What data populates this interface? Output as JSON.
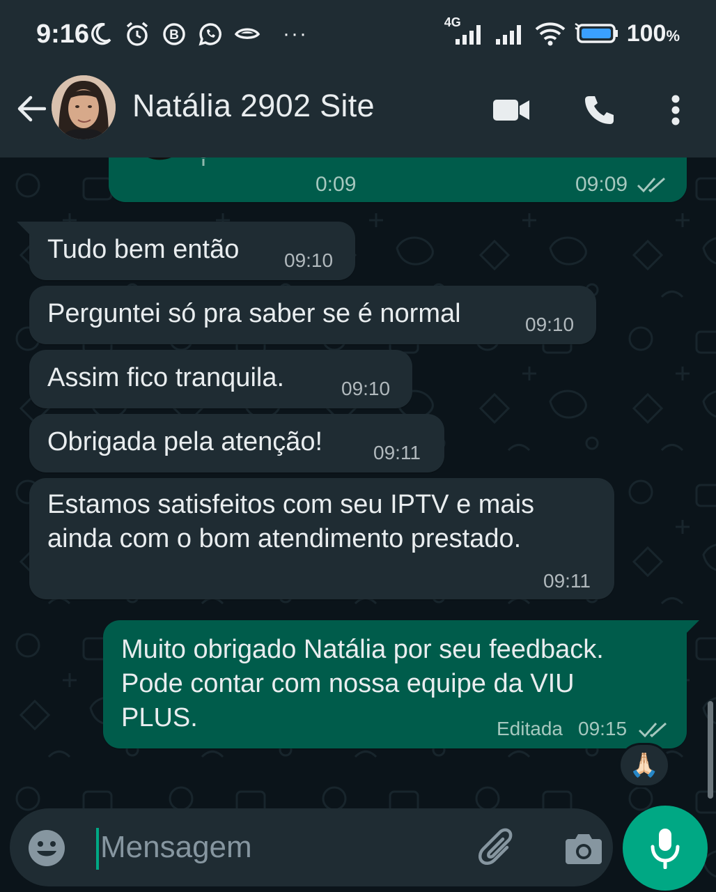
{
  "status_bar": {
    "time": "9:16",
    "network_label": "4G",
    "battery_percent": "100",
    "battery_unit": "%",
    "notification_icons": [
      "moon-icon",
      "alarm-icon",
      "b-badge-icon",
      "whatsapp-icon",
      "eye-icon",
      "more-dots-icon"
    ],
    "more_label": "···"
  },
  "header": {
    "contact_name": "Natália 2902 Site",
    "icons": [
      "back-arrow-icon",
      "video-call-icon",
      "voice-call-icon",
      "overflow-menu-icon"
    ]
  },
  "messages": [
    {
      "direction": "out",
      "type": "voice",
      "duration": "0:09",
      "time": "09:09",
      "status": "read"
    },
    {
      "direction": "in",
      "text": "Tudo bem então",
      "time": "09:10"
    },
    {
      "direction": "in",
      "text": "Perguntei só pra saber se é normal",
      "time": "09:10"
    },
    {
      "direction": "in",
      "text": "Assim fico tranquila.",
      "time": "09:10"
    },
    {
      "direction": "in",
      "text": "Obrigada pela atenção!",
      "time": "09:11"
    },
    {
      "direction": "in",
      "text": "Estamos satisfeitos com seu IPTV e mais\nainda com o bom atendimento prestado.",
      "time": "09:11"
    },
    {
      "direction": "out",
      "text": "Muito obrigado Natália por seu feedback.\nPode contar com nossa equipe da VIU\nPLUS.",
      "edited_label": "Editada",
      "time": "09:15",
      "status": "read",
      "reaction": "🙏🏻"
    }
  ],
  "composer": {
    "placeholder": "Mensagem",
    "value": ""
  },
  "colors": {
    "header_bg": "#1f2c33",
    "chat_bg": "#0b141a",
    "incoming_bubble": "#1f2c33",
    "outgoing_bubble": "#005c4b",
    "accent": "#00a884",
    "read_ticks": "#a6c8bf"
  }
}
